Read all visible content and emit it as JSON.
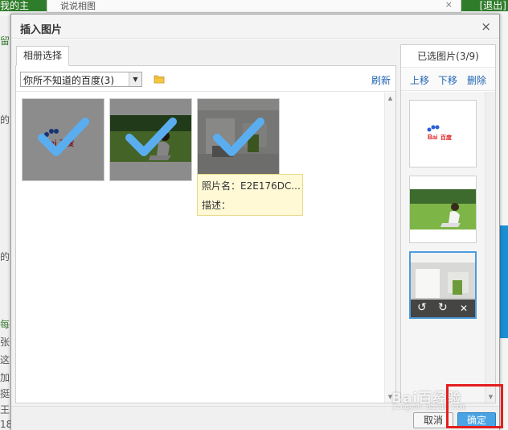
{
  "background": {
    "top_left_text": "我的主",
    "top_right_text": "[退出]",
    "tab_title": "说说相图",
    "left_texts": [
      "留",
      "的",
      "的",
      "每",
      "张",
      "这",
      "加",
      "挺",
      "王",
      "18"
    ]
  },
  "dialog": {
    "title": "插入图片",
    "close_glyph": "×"
  },
  "left_panel": {
    "tab_label": "相册选择",
    "album_select_value": "你所不知道的百度(3)",
    "refresh_label": "刷新",
    "photos": [
      {
        "name": "baidu-logo-photo",
        "selected": true
      },
      {
        "name": "girl-on-grass-photo",
        "selected": true
      },
      {
        "name": "office-room-photo",
        "selected": true
      }
    ],
    "tooltip": {
      "name_label": "照片名：",
      "name_value": "E2E176DC...",
      "desc_label": "描述："
    }
  },
  "right_panel": {
    "title": "已选图片(3/9)",
    "move_up": "上移",
    "move_down": "下移",
    "delete": "删除",
    "selected_items": [
      {
        "name": "baidu-logo-thumb"
      },
      {
        "name": "girl-on-grass-thumb"
      },
      {
        "name": "office-room-thumb",
        "active": true
      }
    ],
    "actions": {
      "rotate_left": "↺",
      "rotate_right": "↻",
      "remove": "✕"
    }
  },
  "footer": {
    "cancel_label": "取消",
    "ok_label": "确定"
  },
  "watermark": {
    "text": "Bai百经验",
    "sub": "jingyan.baidu.com"
  },
  "colors": {
    "accent_blue": "#4aa3e3",
    "link_blue": "#2166b3",
    "highlight_red": "#e41e1e",
    "check_blue": "#5aaef0"
  }
}
